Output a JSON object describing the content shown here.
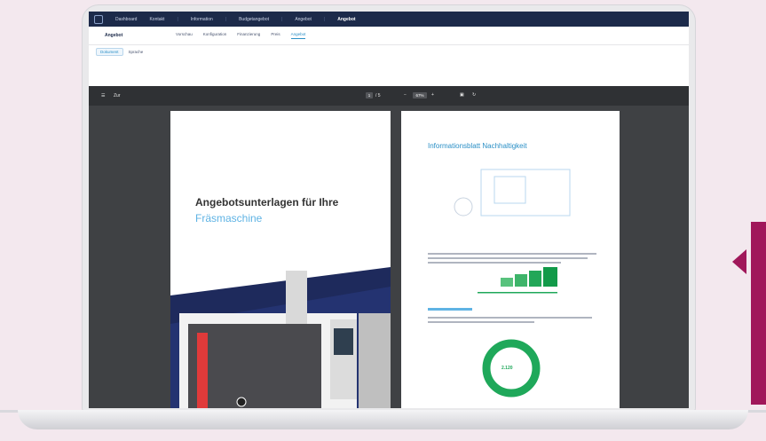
{
  "topnav": {
    "items": [
      "Dashboard",
      "Kontakt",
      "Information",
      "Budgetangebot",
      "Angebot",
      "Angebot"
    ]
  },
  "subnav": {
    "title": "Angebot",
    "tabs": [
      "Vorschau",
      "Konfiguration",
      "Finanzierung",
      "Preis",
      "Angebot"
    ]
  },
  "toolbar": {
    "dropdown": "Dokument",
    "language": "Sprache"
  },
  "viewer": {
    "menu_label": "Zur",
    "page_current": "1",
    "page_total": "/ 5",
    "zoom": "67%"
  },
  "cover": {
    "title_line1": "Angebotsunterlagen für Ihre",
    "title_line2": "Fräsmaschine"
  },
  "info_page": {
    "title": "Informationsblatt Nachhaltigkeit",
    "center_value": "2.120"
  },
  "colors": {
    "accent": "#a0175a",
    "nav": "#1c2a4a",
    "blue": "#2a8fc6",
    "green": "#1fa85a"
  }
}
